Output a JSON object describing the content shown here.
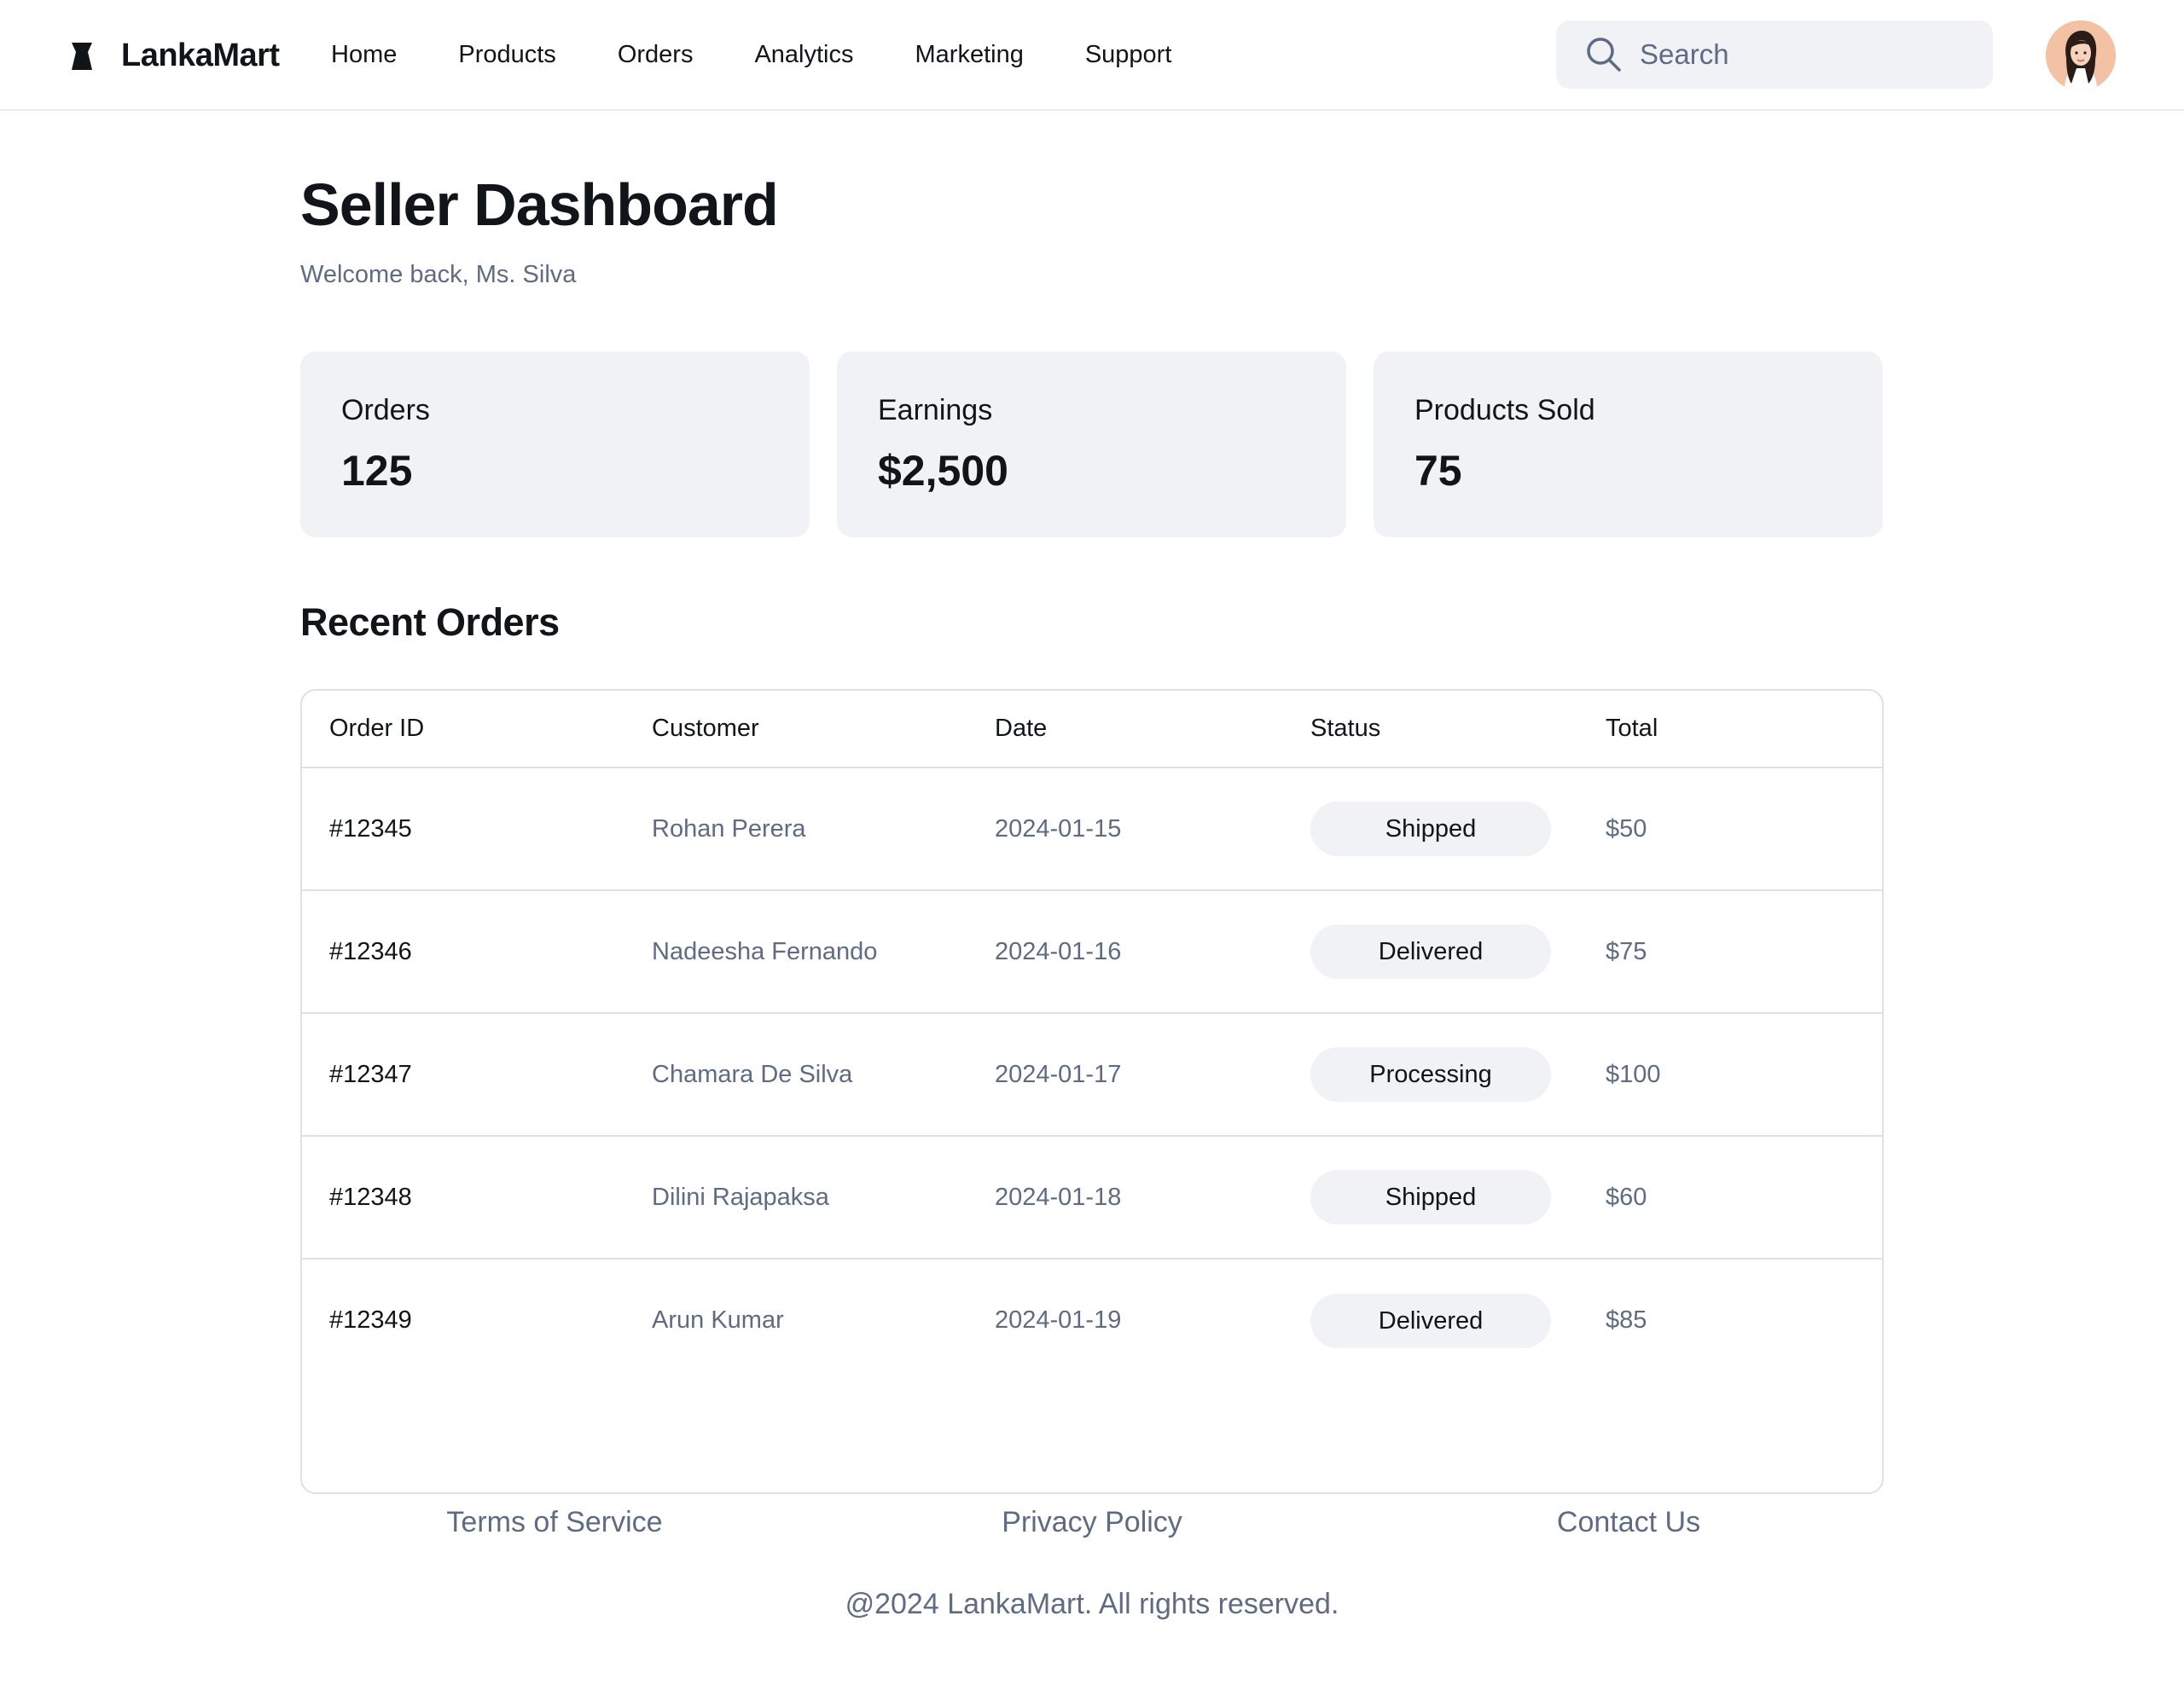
{
  "brand": {
    "name": "LankaMart"
  },
  "nav": {
    "items": [
      {
        "label": "Home"
      },
      {
        "label": "Products"
      },
      {
        "label": "Orders"
      },
      {
        "label": "Analytics"
      },
      {
        "label": "Marketing"
      },
      {
        "label": "Support"
      }
    ]
  },
  "search": {
    "placeholder": "Search",
    "value": ""
  },
  "header": {
    "title": "Seller Dashboard",
    "welcome": "Welcome back, Ms. Silva"
  },
  "stats": [
    {
      "label": "Orders",
      "value": "125"
    },
    {
      "label": "Earnings",
      "value": "$2,500"
    },
    {
      "label": "Products Sold",
      "value": "75"
    }
  ],
  "recent_orders": {
    "title": "Recent Orders",
    "columns": [
      "Order ID",
      "Customer",
      "Date",
      "Status",
      "Total"
    ],
    "rows": [
      {
        "id": "#12345",
        "customer": "Rohan Perera",
        "date": "2024-01-15",
        "status": "Shipped",
        "total": "$50"
      },
      {
        "id": "#12346",
        "customer": "Nadeesha Fernando",
        "date": "2024-01-16",
        "status": "Delivered",
        "total": "$75"
      },
      {
        "id": "#12347",
        "customer": "Chamara De Silva",
        "date": "2024-01-17",
        "status": "Processing",
        "total": "$100"
      },
      {
        "id": "#12348",
        "customer": "Dilini Rajapaksa",
        "date": "2024-01-18",
        "status": "Shipped",
        "total": "$60"
      },
      {
        "id": "#12349",
        "customer": "Arun Kumar",
        "date": "2024-01-19",
        "status": "Delivered",
        "total": "$85"
      }
    ]
  },
  "footer": {
    "links": [
      {
        "label": "Terms of Service"
      },
      {
        "label": "Privacy Policy"
      },
      {
        "label": "Contact Us"
      }
    ],
    "copyright": "@2024 LankaMart. All rights reserved."
  },
  "icons": {
    "logo": "logo-mark-icon",
    "search": "search-icon",
    "avatar": "user-avatar"
  },
  "colors": {
    "text": "#111418",
    "muted": "#5e6b85",
    "card": "#f0f2f5",
    "border": "#dde1e7"
  }
}
